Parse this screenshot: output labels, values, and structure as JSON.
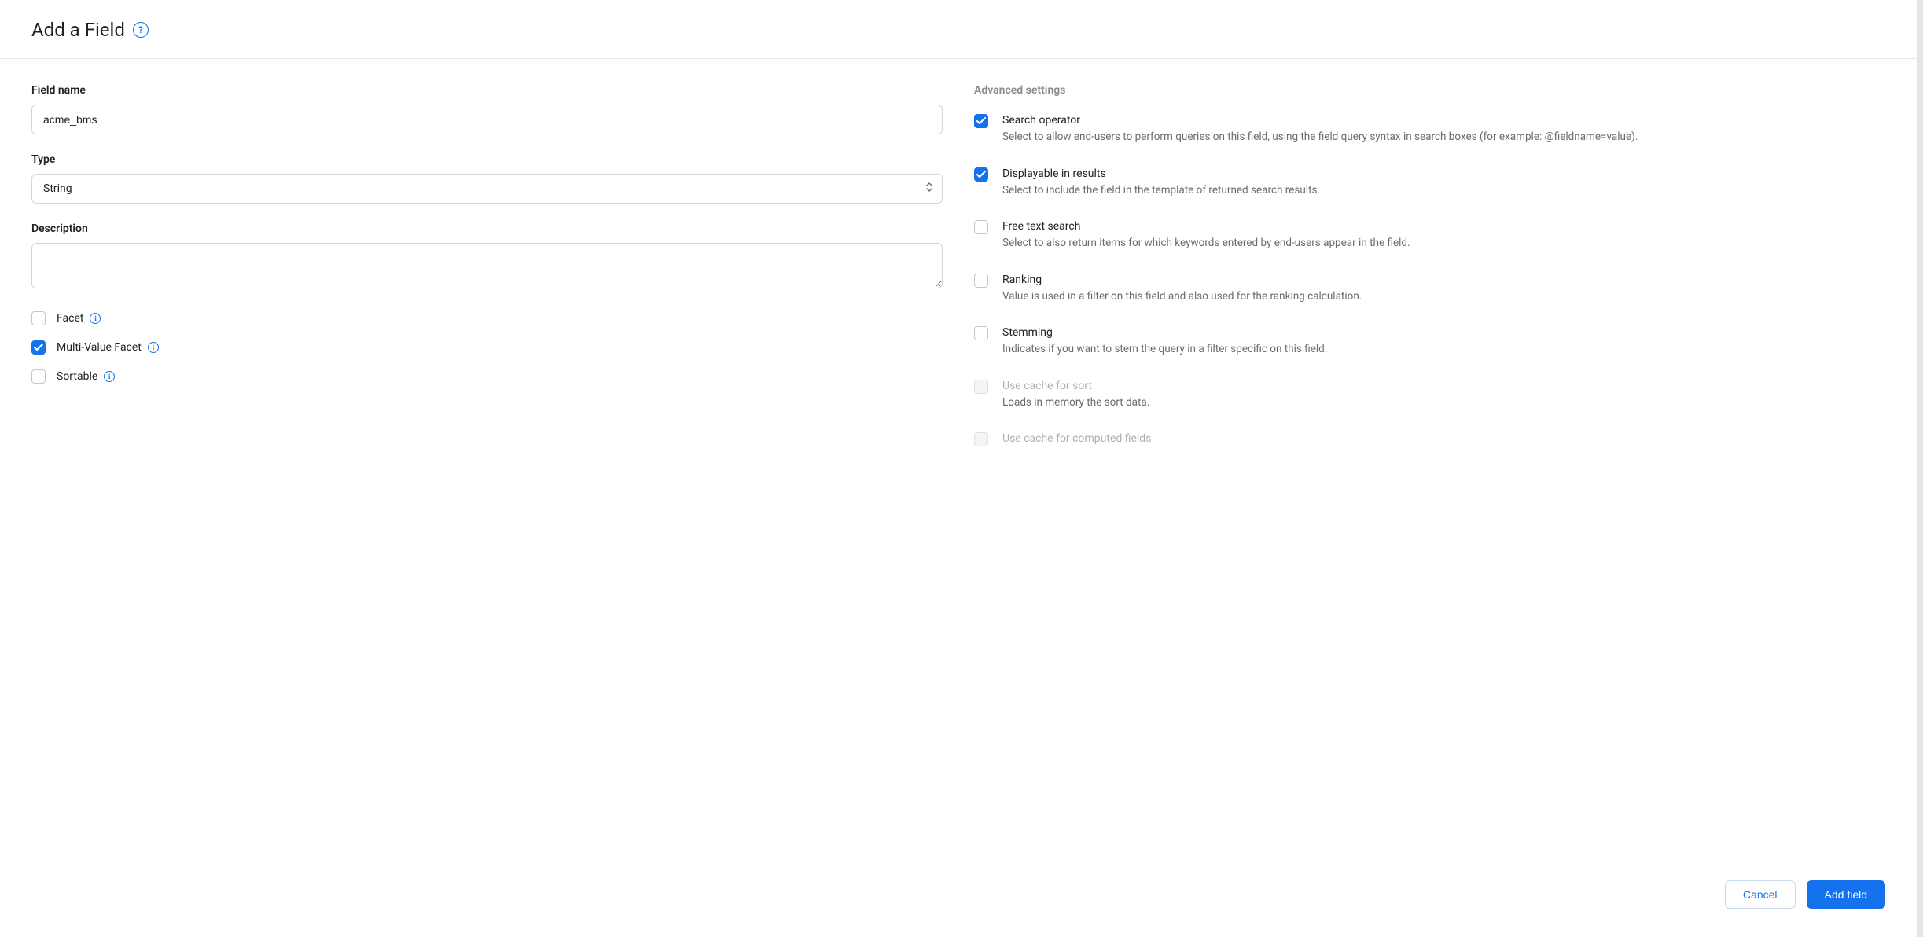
{
  "header": {
    "title": "Add a Field"
  },
  "left": {
    "fieldNameLabel": "Field name",
    "fieldNameValue": "acme_bms",
    "typeLabel": "Type",
    "typeValue": "String",
    "descriptionLabel": "Description",
    "descriptionValue": "",
    "facet": {
      "label": "Facet",
      "checked": false
    },
    "multiValueFacet": {
      "label": "Multi-Value Facet",
      "checked": true
    },
    "sortable": {
      "label": "Sortable",
      "checked": false
    }
  },
  "right": {
    "advancedHeader": "Advanced settings",
    "items": [
      {
        "key": "search-operator",
        "title": "Search operator",
        "desc": "Select to allow end-users to perform queries on this field, using the field query syntax in search boxes (for example: @fieldname=value).",
        "checked": true,
        "disabled": false
      },
      {
        "key": "displayable",
        "title": "Displayable in results",
        "desc": "Select to include the field in the template of returned search results.",
        "checked": true,
        "disabled": false
      },
      {
        "key": "free-text",
        "title": "Free text search",
        "desc": "Select to also return items for which keywords entered by end-users appear in the field.",
        "checked": false,
        "disabled": false
      },
      {
        "key": "ranking",
        "title": "Ranking",
        "desc": "Value is used in a filter on this field and also used for the ranking calculation.",
        "checked": false,
        "disabled": false
      },
      {
        "key": "stemming",
        "title": "Stemming",
        "desc": "Indicates if you want to stem the query in a filter specific on this field.",
        "checked": false,
        "disabled": false
      },
      {
        "key": "cache-sort",
        "title": "Use cache for sort",
        "desc": "Loads in memory the sort data.",
        "checked": false,
        "disabled": true
      },
      {
        "key": "cache-computed",
        "title": "Use cache for computed fields",
        "desc": "",
        "checked": false,
        "disabled": true
      }
    ]
  },
  "footer": {
    "cancel": "Cancel",
    "submit": "Add field"
  }
}
